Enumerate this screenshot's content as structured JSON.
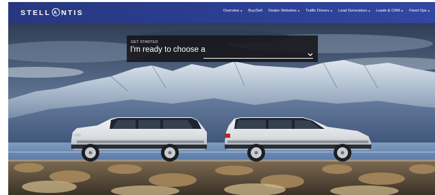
{
  "brand": {
    "name": "STELLANTIS"
  },
  "nav": {
    "items": [
      {
        "label": "Overview",
        "dropdown": true
      },
      {
        "label": "Buy/Sell",
        "dropdown": false
      },
      {
        "label": "Dealer Websites",
        "dropdown": true
      },
      {
        "label": "Traffic Drivers",
        "dropdown": true
      },
      {
        "label": "Lead Generators",
        "dropdown": true
      },
      {
        "label": "Leads & CRM",
        "dropdown": true
      },
      {
        "label": "Fixed Ops",
        "dropdown": true
      }
    ],
    "dropdown_icon": "caret-down-icon"
  },
  "hero": {
    "eyebrow": "GET STARTED",
    "selector_text": "I'm ready to choose a",
    "selector_icon": "chevron-down-icon",
    "image": "two white SUVs parked by a lake with snow-capped mountains"
  },
  "colors": {
    "nav_bg": "#2b3d8f",
    "panel_bg": "#161618",
    "text": "#ffffff"
  }
}
